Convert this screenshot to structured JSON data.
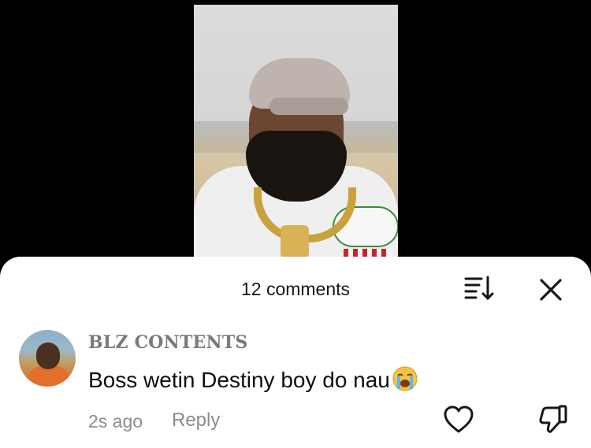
{
  "comments_panel": {
    "count_label": "12 comments",
    "sort_icon": "sort-icon",
    "close_icon": "close-icon"
  },
  "comment": {
    "username": "BLZ CONTENTS",
    "text": "Boss wetin Destiny boy do nau",
    "emoji": "crying-emoji",
    "time": "2s ago",
    "reply_label": "Reply",
    "like_icon": "heart-icon",
    "dislike_icon": "thumbs-down-icon"
  },
  "colors": {
    "sheet_bg": "#ffffff",
    "text_primary": "#0e0e0e",
    "text_secondary": "#8b8b8b"
  }
}
